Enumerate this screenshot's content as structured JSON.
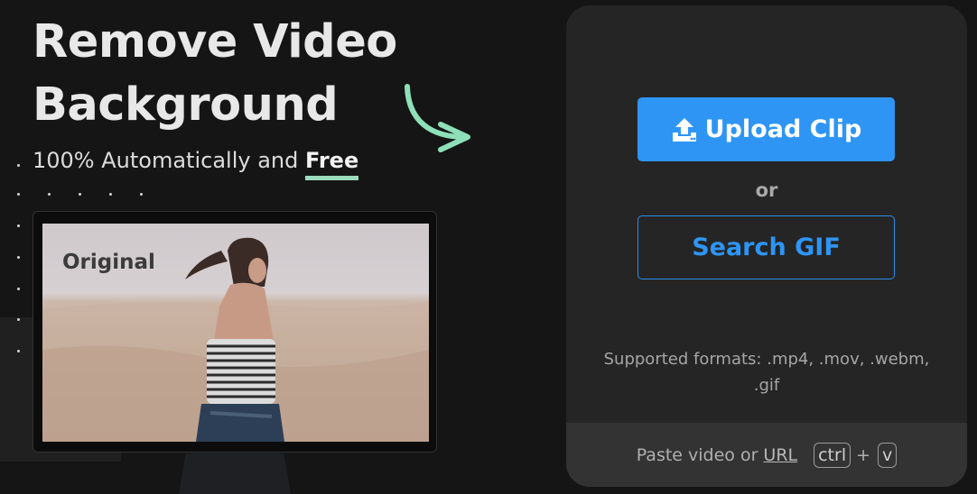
{
  "hero": {
    "title_line1": "Remove Video",
    "title_line2": "Background",
    "subtitle_prefix": "100% Automatically and ",
    "subtitle_highlight": "Free"
  },
  "preview": {
    "label": "Original"
  },
  "upload": {
    "button_label": "Upload Clip",
    "icon": "upload-icon"
  },
  "separator": "or",
  "search": {
    "button_label": "Search GIF"
  },
  "formats": {
    "line1": "Supported formats: .mp4, .mov, .webm,",
    "line2": ".gif"
  },
  "paste": {
    "text": "Paste video or",
    "url_label": "URL",
    "key1": "ctrl",
    "plus": "+",
    "key2": "v"
  },
  "colors": {
    "accent_blue": "#2e95f5",
    "underline_green": "#9cdcbc",
    "arrow_green": "#8ee0b8",
    "card_bg": "#252525",
    "page_bg": "#151515"
  }
}
